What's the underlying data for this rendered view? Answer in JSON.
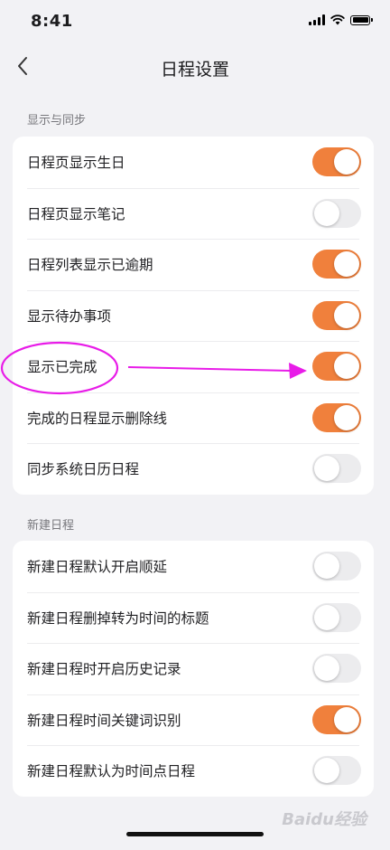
{
  "status_bar": {
    "time": "8:41"
  },
  "nav": {
    "title": "日程设置"
  },
  "sections": [
    {
      "header": "显示与同步",
      "items": [
        {
          "label": "日程页显示生日",
          "on": true
        },
        {
          "label": "日程页显示笔记",
          "on": false
        },
        {
          "label": "日程列表显示已逾期",
          "on": true
        },
        {
          "label": "显示待办事项",
          "on": true
        },
        {
          "label": "显示已完成",
          "on": true
        },
        {
          "label": "完成的日程显示删除线",
          "on": true
        },
        {
          "label": "同步系统日历日程",
          "on": false
        }
      ]
    },
    {
      "header": "新建日程",
      "items": [
        {
          "label": "新建日程默认开启顺延",
          "on": false
        },
        {
          "label": "新建日程删掉转为时间的标题",
          "on": false
        },
        {
          "label": "新建日程时开启历史记录",
          "on": false
        },
        {
          "label": "新建日程时间关键词识别",
          "on": true
        },
        {
          "label": "新建日程默认为时间点日程",
          "on": false
        }
      ]
    }
  ],
  "colors": {
    "accent": "#f0803c",
    "toggle_off": "#ececee",
    "annotation": "#e81ce8"
  },
  "watermark": "Baidu经验"
}
